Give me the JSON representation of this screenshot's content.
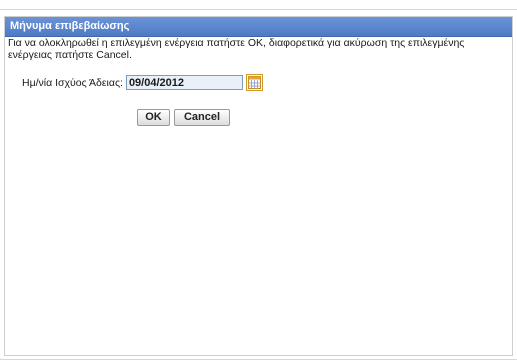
{
  "dialog": {
    "title": "Μήνυμα επιβεβαίωσης",
    "message": "Για να ολοκληρωθεί η επιλεγμένη ενέργεια πατήστε OK, διαφορετικά για ακύρωση της επιλεγμένης ενέργειας πατήστε Cancel.",
    "date_label": "Ημ/νία Ισχύος Άδειας:",
    "date_value": "09/04/2012",
    "calendar_icon": "calendar-icon",
    "ok_label": "OK",
    "cancel_label": "Cancel"
  },
  "colors": {
    "titlebar": "#5582cc",
    "title_text": "#ffffff",
    "input_bg": "#eaf0f8",
    "calendar_border": "#d19b2e"
  }
}
